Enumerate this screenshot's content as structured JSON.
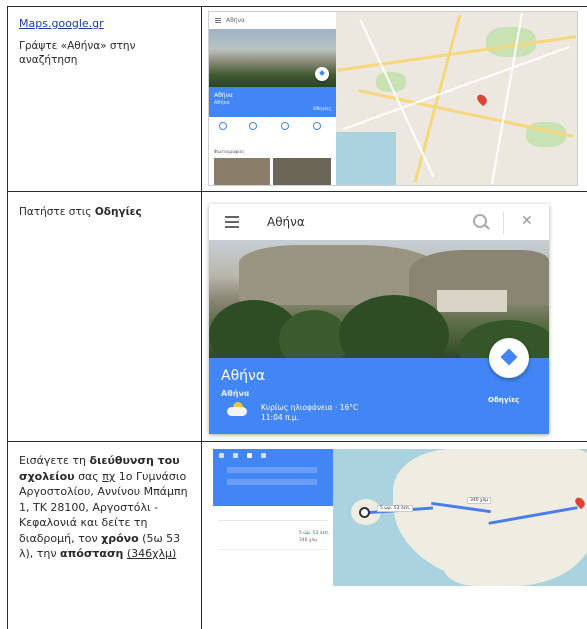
{
  "rows": [
    {
      "link": "Maps.google.gr",
      "instruction": "Γράψτε «Αθήνα» στην αναζήτηση"
    },
    {
      "instruction_prefix": "Πατήστε στις ",
      "instruction_bold": "Οδηγίες"
    },
    {
      "parts": [
        {
          "t": "Εισάγετε τη ",
          "s": ""
        },
        {
          "t": "διεύθυνση του σχολείου",
          "s": "b"
        },
        {
          "t": " σας ",
          "s": ""
        },
        {
          "t": "πχ",
          "s": "u"
        },
        {
          "t": " 1ο Γυμνάσιο Αργοστολίου, Αννίνου Μπάμπη 1, ΤΚ 28100, Αργοστόλι - Κεφαλονιά και δείτε τη διαδρομή, τον ",
          "s": ""
        },
        {
          "t": "χρόνο",
          "s": "b"
        },
        {
          "t": " (5ω 53 λ), την ",
          "s": ""
        },
        {
          "t": "απόσταση",
          "s": "b"
        },
        {
          "t": " ",
          "s": ""
        },
        {
          "t": "(346χλμ)",
          "s": "u"
        }
      ]
    }
  ],
  "screens": {
    "first": {
      "search_text": "Αθήνα",
      "place": "Αθήνα",
      "place_sub": "Αθήνα",
      "directions": "Οδηγίες",
      "photos_label": "Φωτογραφίες"
    },
    "second": {
      "search_text": "Αθήνα",
      "place": "Αθήνα",
      "place_sub": "Αθήνα",
      "weather": "Κυρίως ηλιοφάνεια · 16°C",
      "time": "11:04 π.μ.",
      "directions": "Οδηγίες",
      "close": "✕"
    },
    "third": {
      "route_badge": "5 ώρ. 53 λεπ.",
      "distance": "346 χλμ"
    }
  },
  "colors": {
    "maps_blue": "#4285f4",
    "route_blue": "#4a7df0",
    "link_blue": "#1a3ea8"
  }
}
